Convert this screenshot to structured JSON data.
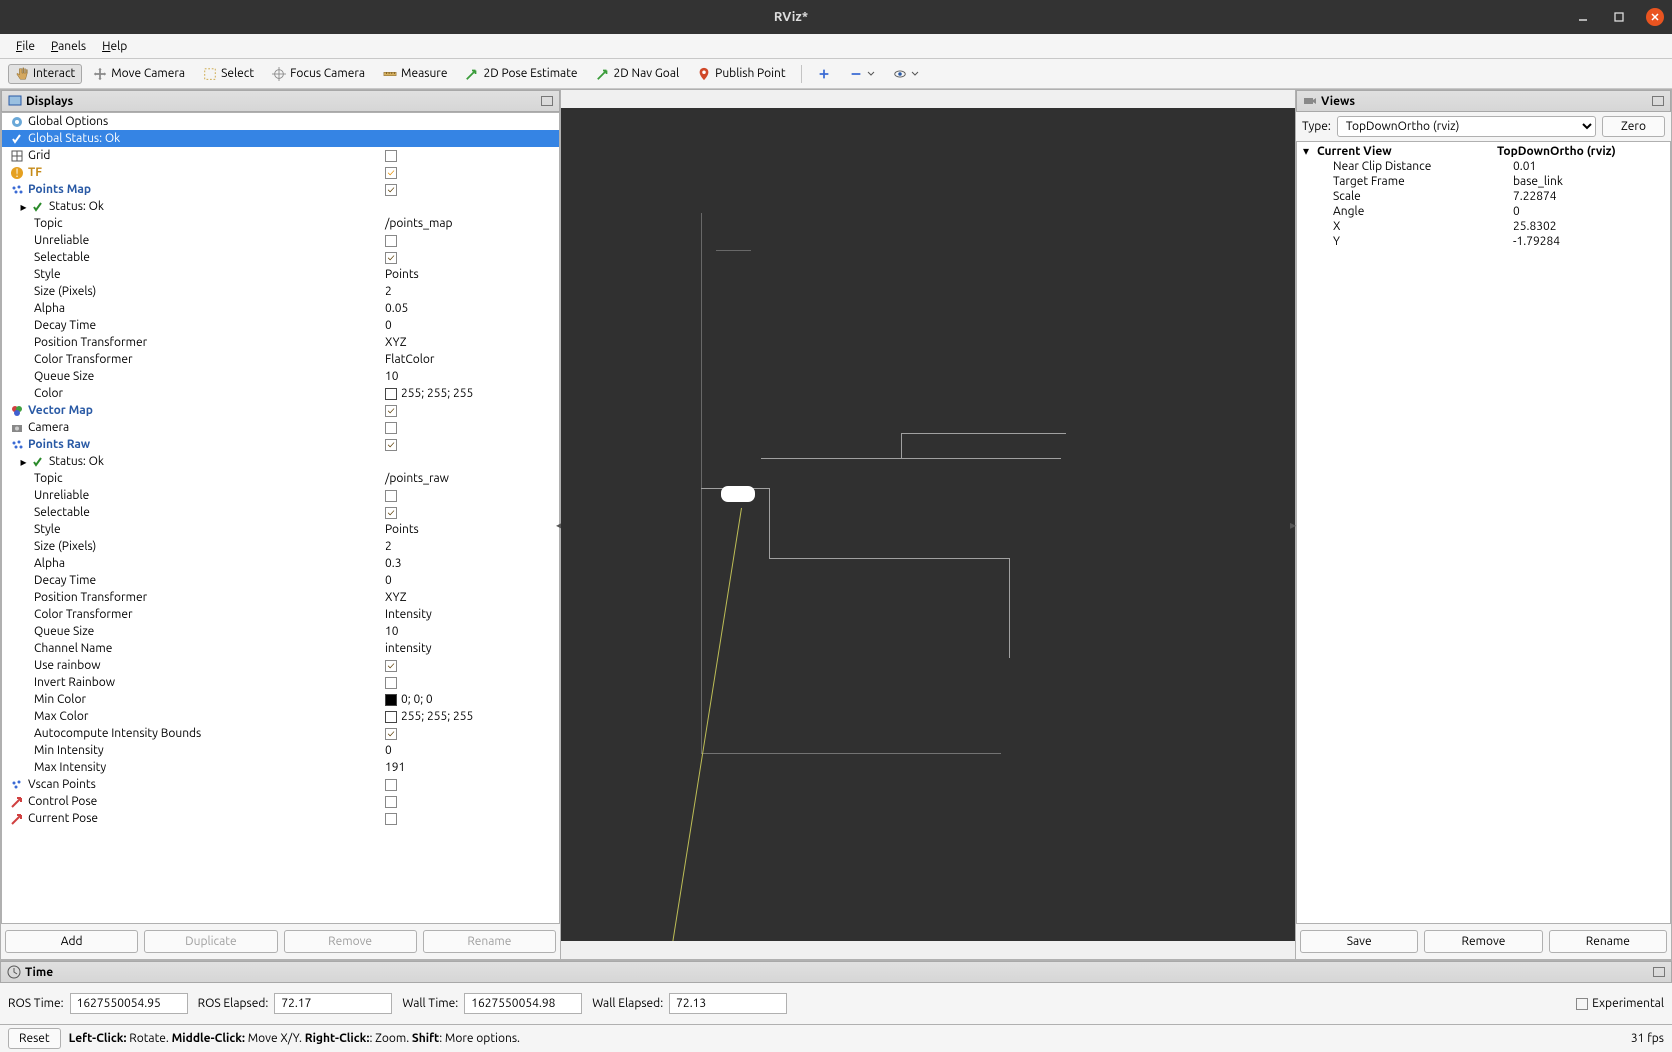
{
  "window": {
    "title": "RViz*"
  },
  "menubar": [
    "File",
    "Panels",
    "Help"
  ],
  "toolbar": {
    "interact": "Interact",
    "move_camera": "Move Camera",
    "select": "Select",
    "focus_camera": "Focus Camera",
    "measure": "Measure",
    "pose_estimate": "2D Pose Estimate",
    "nav_goal": "2D Nav Goal",
    "publish_point": "Publish Point"
  },
  "displays": {
    "title": "Displays",
    "items": {
      "global_options": "Global Options",
      "global_status": "Global Status: Ok",
      "grid": "Grid",
      "tf": "TF",
      "points_map": "Points Map",
      "pm_status": "Status: Ok",
      "pm": {
        "topic_l": "Topic",
        "topic_v": "/points_map",
        "unreliable_l": "Unreliable",
        "selectable_l": "Selectable",
        "style_l": "Style",
        "style_v": "Points",
        "size_l": "Size (Pixels)",
        "size_v": "2",
        "alpha_l": "Alpha",
        "alpha_v": "0.05",
        "decay_l": "Decay Time",
        "decay_v": "0",
        "pos_l": "Position Transformer",
        "pos_v": "XYZ",
        "col_l": "Color Transformer",
        "col_v": "FlatColor",
        "queue_l": "Queue Size",
        "queue_v": "10",
        "color_l": "Color",
        "color_v": "255; 255; 255"
      },
      "vector_map": "Vector Map",
      "camera": "Camera",
      "points_raw": "Points Raw",
      "pr_status": "Status: Ok",
      "pr": {
        "topic_l": "Topic",
        "topic_v": "/points_raw",
        "unreliable_l": "Unreliable",
        "selectable_l": "Selectable",
        "style_l": "Style",
        "style_v": "Points",
        "size_l": "Size (Pixels)",
        "size_v": "2",
        "alpha_l": "Alpha",
        "alpha_v": "0.3",
        "decay_l": "Decay Time",
        "decay_v": "0",
        "pos_l": "Position Transformer",
        "pos_v": "XYZ",
        "col_l": "Color Transformer",
        "col_v": "Intensity",
        "queue_l": "Queue Size",
        "queue_v": "10",
        "chan_l": "Channel Name",
        "chan_v": "intensity",
        "rainbow_l": "Use rainbow",
        "invert_l": "Invert Rainbow",
        "mincol_l": "Min Color",
        "mincol_v": "0; 0; 0",
        "maxcol_l": "Max Color",
        "maxcol_v": "255; 255; 255",
        "auto_l": "Autocompute Intensity Bounds",
        "minint_l": "Min Intensity",
        "minint_v": "0",
        "maxint_l": "Max Intensity",
        "maxint_v": "191"
      },
      "vscan": "Vscan Points",
      "control_pose": "Control Pose",
      "current_pose": "Current Pose"
    },
    "buttons": {
      "add": "Add",
      "duplicate": "Duplicate",
      "remove": "Remove",
      "rename": "Rename"
    }
  },
  "views": {
    "title": "Views",
    "type_label": "Type:",
    "type_value": "TopDownOrtho (rviz)",
    "zero": "Zero",
    "current": {
      "header_l": "Current View",
      "header_v": "TopDownOrtho (rviz)",
      "near_l": "Near Clip Distance",
      "near_v": "0.01",
      "target_l": "Target Frame",
      "target_v": "base_link",
      "scale_l": "Scale",
      "scale_v": "7.22874",
      "angle_l": "Angle",
      "angle_v": "0",
      "x_l": "X",
      "x_v": "25.8302",
      "y_l": "Y",
      "y_v": "-1.79284"
    },
    "buttons": {
      "save": "Save",
      "remove": "Remove",
      "rename": "Rename"
    }
  },
  "time": {
    "title": "Time",
    "ros_time_l": "ROS Time:",
    "ros_time_v": "1627550054.95",
    "ros_elapsed_l": "ROS Elapsed:",
    "ros_elapsed_v": "72.17",
    "wall_time_l": "Wall Time:",
    "wall_time_v": "1627550054.98",
    "wall_elapsed_l": "Wall Elapsed:",
    "wall_elapsed_v": "72.13",
    "experimental": "Experimental"
  },
  "status": {
    "reset": "Reset",
    "hint_left": "Left-Click:",
    "hint_left_v": " Rotate. ",
    "hint_mid": "Middle-Click:",
    "hint_mid_v": " Move X/Y. ",
    "hint_right": "Right-Click:",
    "hint_right_v": ": Zoom. ",
    "hint_shift": "Shift",
    "hint_shift_v": ": More options.",
    "fps": "31 fps"
  }
}
